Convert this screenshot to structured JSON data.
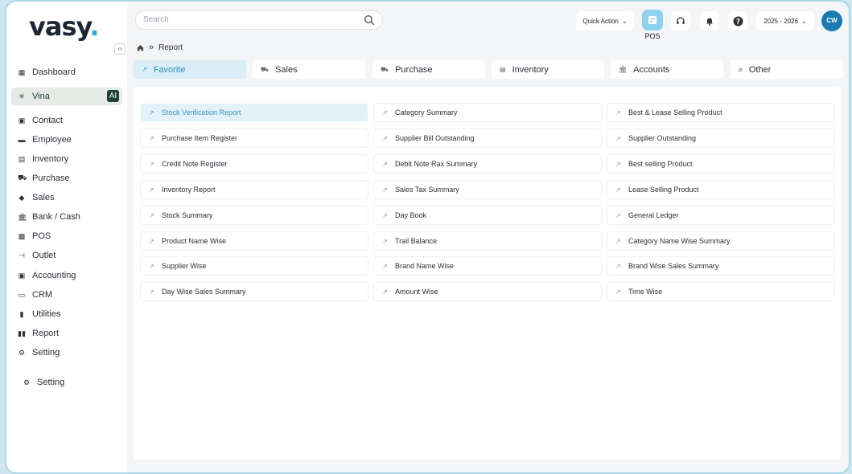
{
  "app": {
    "logo": "vasy",
    "logo_dot": "."
  },
  "search": {
    "placeholder": "Search"
  },
  "topbar": {
    "quick_action": "Quick Action",
    "pos_label": "POS",
    "year": "2025 - 2026",
    "avatar": "CW"
  },
  "breadcrumb": {
    "page": "Report"
  },
  "sidebar": {
    "items": [
      {
        "label": "Dashboard",
        "icon": "dashboard-icon"
      },
      {
        "label": "Vina",
        "icon": "sparkle-icon",
        "badge": "AI"
      },
      {
        "label": "Contact",
        "icon": "contact-icon"
      },
      {
        "label": "Employee",
        "icon": "employee-icon"
      },
      {
        "label": "Inventory",
        "icon": "inventory-icon"
      },
      {
        "label": "Purchase",
        "icon": "purchase-icon"
      },
      {
        "label": "Sales",
        "icon": "sales-icon"
      },
      {
        "label": "Bank / Cash",
        "icon": "bank-icon"
      },
      {
        "label": "POS",
        "icon": "pos-icon"
      },
      {
        "label": "Outlet",
        "icon": "outlet-icon"
      },
      {
        "label": "Accounting",
        "icon": "accounting-icon"
      },
      {
        "label": "CRM",
        "icon": "crm-icon"
      },
      {
        "label": "Utilities",
        "icon": "utilities-icon"
      },
      {
        "label": "Report",
        "icon": "report-icon"
      },
      {
        "label": "Setting",
        "icon": "gear-icon"
      }
    ],
    "footer_setting": "Setting"
  },
  "tabs": [
    {
      "label": "Favorite",
      "icon": "favorite-icon",
      "active": true
    },
    {
      "label": "Sales",
      "icon": "sales-icon"
    },
    {
      "label": "Purchase",
      "icon": "purchase-icon"
    },
    {
      "label": "Inventory",
      "icon": "inventory-icon"
    },
    {
      "label": "Accounts",
      "icon": "accounts-icon"
    },
    {
      "label": "Other",
      "icon": "other-icon"
    }
  ],
  "reports": {
    "col1": [
      "Stock Verification Report",
      "Purchase Item Register",
      "Credit Note Register",
      "Inventory Report",
      "Stock Summary",
      "Product Name Wise",
      "Supplier Wise",
      "Day Wise Sales Summary"
    ],
    "col2": [
      "Category Summary",
      "Supplier Bill Outstanding",
      "Debit Note Rax Summary",
      "Sales Tax Summary",
      "Day Book",
      "Trail Balance",
      "Brand Name Wise",
      "Amount Wise"
    ],
    "col3": [
      "Best & Lease Selling Product",
      "Supplier Outstanding",
      "Best selling Product",
      "Lease Selling Product",
      "General Ledger",
      "Category Name Wise Summary",
      "Brand Wise Sales Summary",
      "Time Wise"
    ]
  },
  "colors": {
    "accent": "#2f8fb8",
    "active_tab_bg": "#d9eef6",
    "ai_badge": "#1e4036",
    "avatar": "#1b7ab0"
  }
}
